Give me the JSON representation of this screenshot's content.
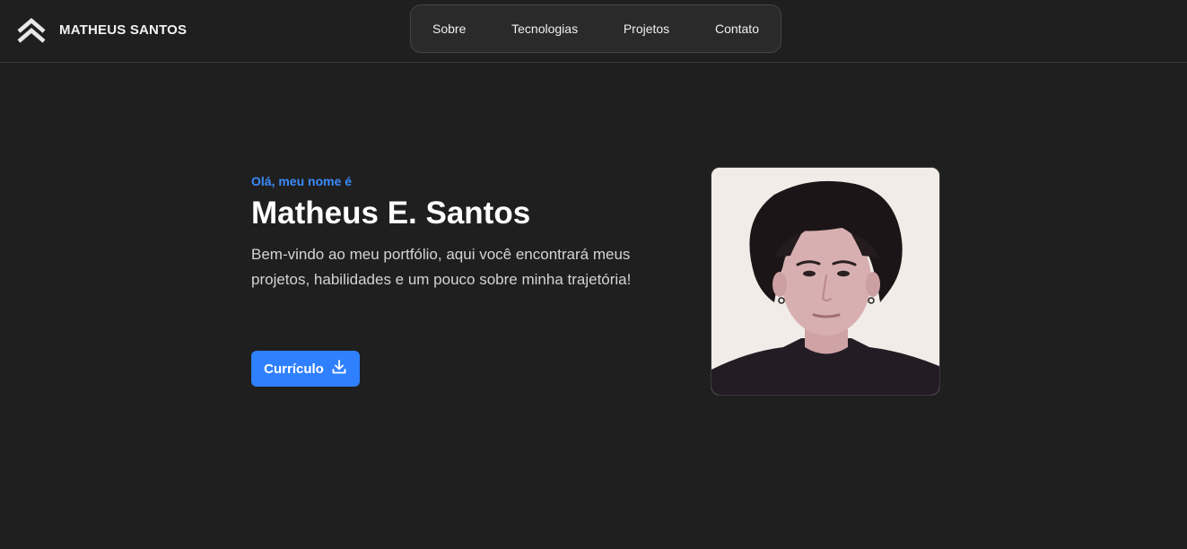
{
  "header": {
    "brand_name": "MATHEUS SANTOS",
    "brand_icon": "double-chevron-up-icon",
    "nav": [
      {
        "label": "Sobre"
      },
      {
        "label": "Tecnologias"
      },
      {
        "label": "Projetos"
      },
      {
        "label": "Contato"
      }
    ]
  },
  "hero": {
    "greeting": "Olá, meu nome é",
    "name": "Matheus E. Santos",
    "description": "Bem-vindo ao meu portfólio, aqui você encontrará meus projetos, habilidades e um pouco sobre minha trajetória!",
    "cv_button_label": "Currículo",
    "cv_button_icon": "download-icon"
  },
  "colors": {
    "background": "#1f1f1f",
    "accent": "#2f80ff",
    "greeting": "#3b8bff"
  }
}
